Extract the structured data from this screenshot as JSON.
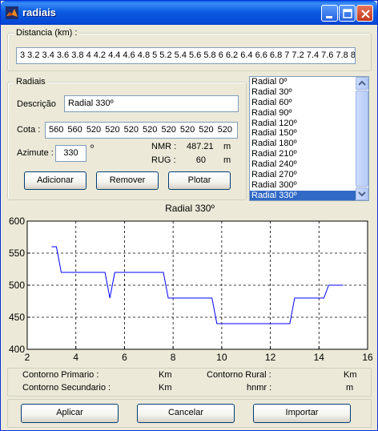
{
  "window": {
    "title": "radiais"
  },
  "distancia": {
    "legend": "Distancia (km) :",
    "value": "3 3.2 3.4 3.6 3.8 4 4.2 4.4 4.6 4.8 5 5.2 5.4 5.6 5.8 6 6.2 6.4 6.6 6.8 7 7.2 7.4 7.6 7.8 8 8"
  },
  "radiais": {
    "legend": "Radiais",
    "descricao_label": "Descrição",
    "descricao_value": "Radial 330º",
    "cota_label": "Cota :",
    "cota_value": "560  560  520  520  520  520  520  520  520  520",
    "azimute_label": "Azimute :",
    "azimute_value": "330",
    "azimute_unit": "º",
    "nmr_label": "NMR :",
    "nmr_value": "487.21",
    "nmr_unit": "m",
    "rug_label": "RUG :",
    "rug_value": "60",
    "rug_unit": "m",
    "buttons": {
      "adicionar": "Adicionar",
      "remover": "Remover",
      "plotar": "Plotar"
    }
  },
  "radial_list": {
    "items": [
      "Radial 0º",
      "Radial 30º",
      "Radial 60º",
      "Radial 90º",
      "Radial 120º",
      "Radial 150º",
      "Radial 180º",
      "Radial 210º",
      "Radial 240º",
      "Radial 270º",
      "Radial 300º",
      "Radial 330º"
    ],
    "selected_index": 11
  },
  "chart_data": {
    "type": "line",
    "title": "Radial 330º",
    "xlabel": "",
    "ylabel": "",
    "xlim": [
      2,
      16
    ],
    "ylim": [
      400,
      600
    ],
    "xticks": [
      2,
      4,
      6,
      8,
      10,
      12,
      14,
      16
    ],
    "yticks": [
      400,
      450,
      500,
      550,
      600
    ],
    "grid": true,
    "series": [
      {
        "color": "#0000ff",
        "x": [
          3.0,
          3.2,
          3.4,
          5.2,
          5.4,
          5.6,
          7.6,
          7.8,
          9.6,
          9.8,
          12.8,
          13.0,
          14.2,
          14.4,
          15.0
        ],
        "y": [
          560,
          560,
          520,
          520,
          480,
          520,
          520,
          480,
          480,
          440,
          440,
          480,
          480,
          500,
          500
        ]
      }
    ]
  },
  "info": {
    "contorno_primario_label": "Contorno Primario :",
    "contorno_primario_unit": "Km",
    "contorno_rural_label": "Contorno Rural :",
    "contorno_rural_unit": "Km",
    "contorno_secundario_label": "Contorno Secundario :",
    "contorno_secundario_unit": "Km",
    "hnmr_label": "hnmr :",
    "hnmr_unit": "m"
  },
  "bottom_buttons": {
    "aplicar": "Aplicar",
    "cancelar": "Cancelar",
    "importar": "Importar"
  }
}
